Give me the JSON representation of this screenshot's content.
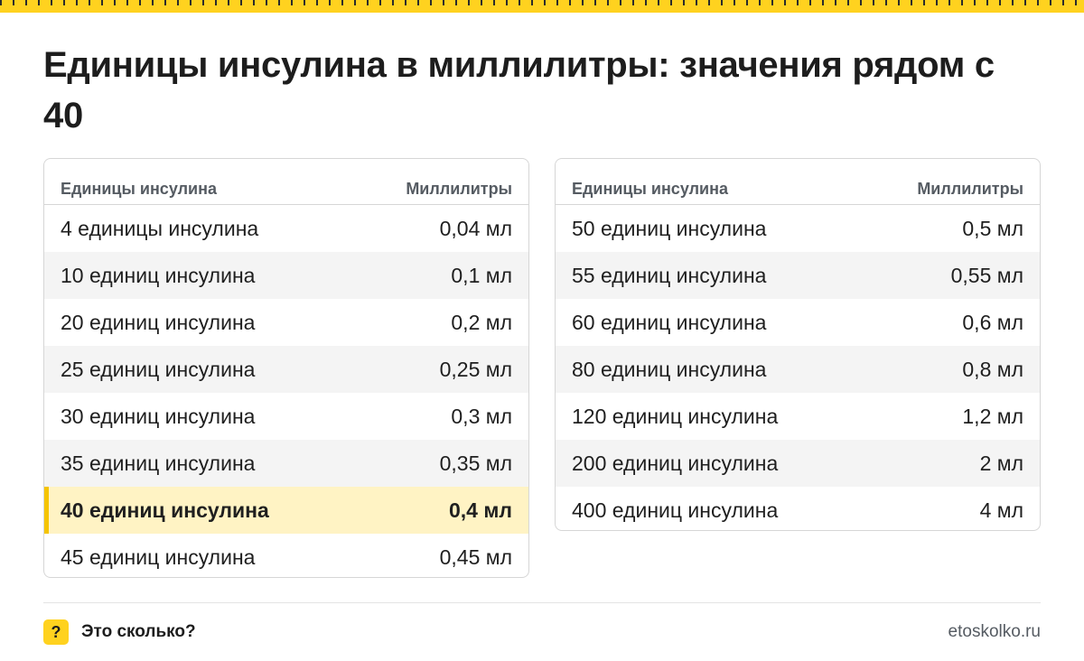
{
  "title": "Единицы инсулина в миллилитры: значения рядом с 40",
  "headers": {
    "units": "Единицы инсулина",
    "ml": "Миллилитры"
  },
  "left_rows": [
    {
      "units": "4 единицы инсулина",
      "ml": "0,04 мл"
    },
    {
      "units": "10 единиц инсулина",
      "ml": "0,1 мл"
    },
    {
      "units": "20 единиц инсулина",
      "ml": "0,2 мл"
    },
    {
      "units": "25 единиц инсулина",
      "ml": "0,25 мл"
    },
    {
      "units": "30 единиц инсулина",
      "ml": "0,3 мл"
    },
    {
      "units": "35 единиц инсулина",
      "ml": "0,35 мл"
    },
    {
      "units": "40 единиц инсулина",
      "ml": "0,4 мл",
      "highlighted": true
    },
    {
      "units": "45 единиц инсулина",
      "ml": "0,45 мл"
    }
  ],
  "right_rows": [
    {
      "units": "50 единиц инсулина",
      "ml": "0,5 мл"
    },
    {
      "units": "55 единиц инсулина",
      "ml": "0,55 мл"
    },
    {
      "units": "60 единиц инсулина",
      "ml": "0,6 мл"
    },
    {
      "units": "80 единиц инсулина",
      "ml": "0,8 мл"
    },
    {
      "units": "120 единиц инсулина",
      "ml": "1,2 мл"
    },
    {
      "units": "200 единиц инсулина",
      "ml": "2 мл"
    },
    {
      "units": "400 единиц инсулина",
      "ml": "4 мл"
    }
  ],
  "footer": {
    "badge": "?",
    "brand": "Это сколько?",
    "site": "etoskolko.ru"
  },
  "colors": {
    "accent": "#ffd21f",
    "highlight_bg": "#fff3c4",
    "highlight_bar": "#f5c400",
    "zebra": "#f4f4f4"
  }
}
